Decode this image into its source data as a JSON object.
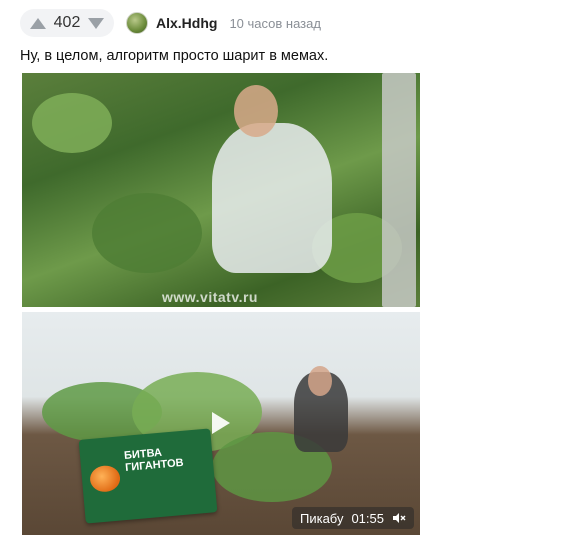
{
  "post": {
    "rating": "402",
    "author": "Alx.Hdhg",
    "time": "10 часов назад",
    "text": "Ну, в целом, алгоритм просто шарит в мемах."
  },
  "image1": {
    "watermark": "www.vitatv.ru"
  },
  "video": {
    "banner_title": "БИТВА ГИГАНТОВ",
    "source": "Пикабу",
    "duration": "01:55"
  },
  "icons": {
    "upvote": "arrow-up-icon",
    "downvote": "arrow-down-icon",
    "play": "play-icon",
    "mute": "speaker-muted-icon"
  }
}
